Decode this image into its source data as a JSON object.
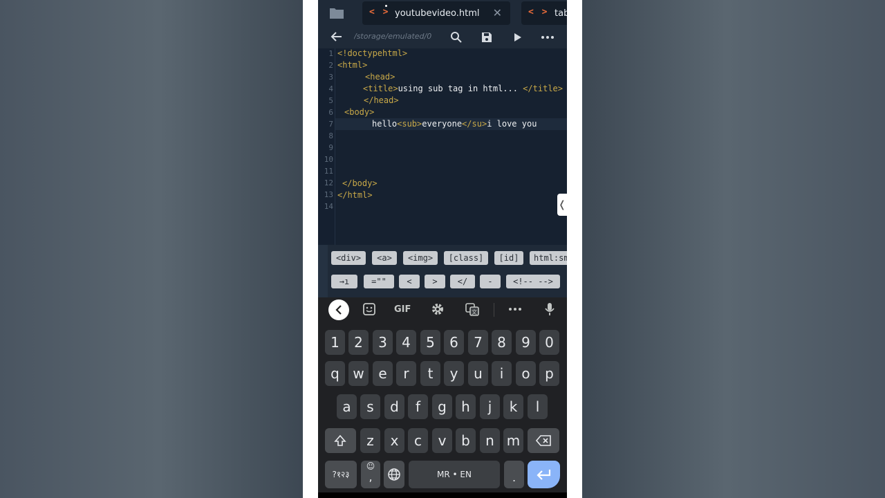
{
  "tabs": [
    {
      "label": "youtubevideo.html",
      "icon": "code-icon",
      "modified": true,
      "close": "✕"
    },
    {
      "label": "tab",
      "icon": "code-icon"
    }
  ],
  "toolbar": {
    "path": "/storage/emulated/0"
  },
  "code_lines": [
    {
      "n": "1"
    },
    {
      "n": "2"
    },
    {
      "n": "3"
    },
    {
      "n": "4"
    },
    {
      "n": "5"
    },
    {
      "n": "6"
    },
    {
      "n": "7"
    },
    {
      "n": "8"
    },
    {
      "n": "9"
    },
    {
      "n": "10"
    },
    {
      "n": "11"
    },
    {
      "n": "12"
    },
    {
      "n": "13"
    },
    {
      "n": "14"
    }
  ],
  "code": {
    "l1": "<!doctypehtml>",
    "l2": "<html>",
    "l3": "<head>",
    "l4_open": "<title>",
    "l4_text": "using sub tag in html... ",
    "l4_close": "</title>",
    "l5": "</head>",
    "l6": "<body>",
    "l7_a": "hello",
    "l7_b": "<sub>",
    "l7_c": "everyone",
    "l7_d": "</su",
    "l7_e": ">",
    "l7_f": "i love you",
    "l12": "</body>",
    "l13": "</html>"
  },
  "snippets_row1": [
    "<div>",
    "<a>",
    "<img>",
    "[class]",
    "[id]",
    "html:sm"
  ],
  "snippets_row2": [
    "→ı",
    "=\"\"",
    "<",
    ">",
    "</",
    "-",
    "<!-- -->"
  ],
  "keyboard": {
    "gif": "GIF",
    "numbers": [
      "1",
      "2",
      "3",
      "4",
      "5",
      "6",
      "7",
      "8",
      "9",
      "0"
    ],
    "row1": [
      "q",
      "w",
      "e",
      "r",
      "t",
      "y",
      "u",
      "i",
      "o",
      "p"
    ],
    "row2": [
      "a",
      "s",
      "d",
      "f",
      "g",
      "h",
      "j",
      "k",
      "l"
    ],
    "row3": [
      "z",
      "x",
      "c",
      "v",
      "b",
      "n",
      "m"
    ],
    "symbols": "?१२३",
    "comma": ",",
    "emoji": "☺",
    "space": "MR • EN",
    "period": "."
  },
  "colors": {
    "tag": "#c9a948",
    "text": "#eef0f2",
    "accent_enter": "#8ab4f8",
    "tab_code": "#e86b3a"
  }
}
